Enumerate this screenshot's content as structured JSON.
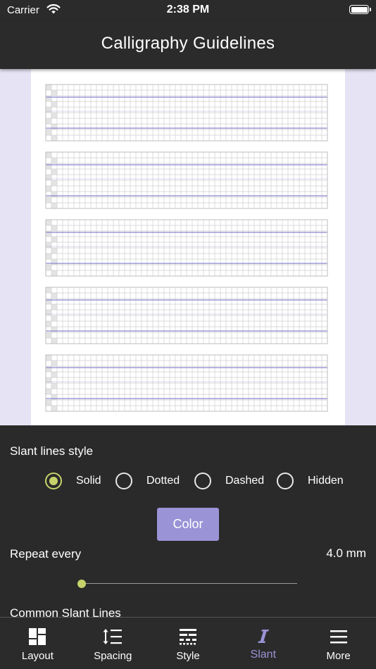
{
  "status": {
    "carrier": "Carrier",
    "time": "2:38 PM"
  },
  "header": {
    "title": "Calligraphy Guidelines"
  },
  "preview": {
    "guide_blocks": 5,
    "line_color": "#8a86d0",
    "grid_color": "#cfcfcf"
  },
  "controls": {
    "slant_style_title": "Slant lines style",
    "slant_styles": [
      {
        "label": "Solid",
        "checked": true
      },
      {
        "label": "Dotted",
        "checked": false
      },
      {
        "label": "Dashed",
        "checked": false
      },
      {
        "label": "Hidden",
        "checked": false
      }
    ],
    "color_button": "Color",
    "repeat_label": "Repeat every",
    "repeat_value": "4.0 mm",
    "repeat_slider_fraction": 0.0,
    "common_title": "Common Slant Lines"
  },
  "tabs": [
    {
      "label": "Layout",
      "icon": "layout-icon",
      "active": false
    },
    {
      "label": "Spacing",
      "icon": "spacing-icon",
      "active": false
    },
    {
      "label": "Style",
      "icon": "style-icon",
      "active": false
    },
    {
      "label": "Slant",
      "icon": "slant-icon",
      "active": true
    },
    {
      "label": "More",
      "icon": "menu-icon",
      "active": false
    }
  ],
  "colors": {
    "accent": "#9a93d6",
    "radio_active": "#c7d36a",
    "background": "#2a2a2a",
    "preview_bg": "#e6e4f4"
  }
}
